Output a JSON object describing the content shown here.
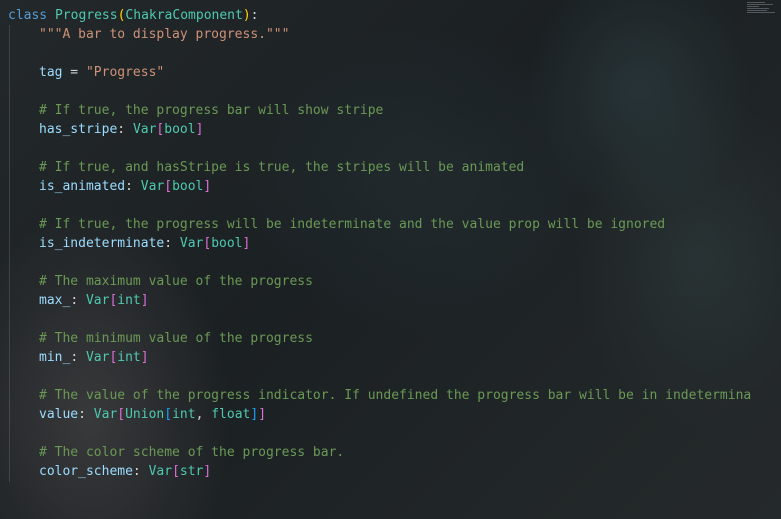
{
  "editor": {
    "lines": [
      {
        "tokens": [
          [
            "kw",
            "class"
          ],
          [
            "op",
            " "
          ],
          [
            "cls",
            "Progress"
          ],
          [
            "paren",
            "("
          ],
          [
            "cls",
            "ChakraComponent"
          ],
          [
            "paren",
            ")"
          ],
          [
            "op",
            ":"
          ]
        ],
        "indent": 0
      },
      {
        "tokens": [
          [
            "str",
            "\"\"\"A bar to display progress.\"\"\""
          ]
        ],
        "indent": 1
      },
      {
        "tokens": [],
        "indent": 0
      },
      {
        "tokens": [
          [
            "id",
            "tag"
          ],
          [
            "op",
            " = "
          ],
          [
            "str",
            "\"Progress\""
          ]
        ],
        "indent": 1
      },
      {
        "tokens": [],
        "indent": 0
      },
      {
        "tokens": [
          [
            "cmt",
            "# If true, the progress bar will show stripe"
          ]
        ],
        "indent": 1
      },
      {
        "tokens": [
          [
            "id",
            "has_stripe"
          ],
          [
            "op",
            ": "
          ],
          [
            "type",
            "Var"
          ],
          [
            "brk",
            "["
          ],
          [
            "type",
            "bool"
          ],
          [
            "brk",
            "]"
          ]
        ],
        "indent": 1
      },
      {
        "tokens": [],
        "indent": 0
      },
      {
        "tokens": [
          [
            "cmt",
            "# If true, and hasStripe is true, the stripes will be animated"
          ]
        ],
        "indent": 1
      },
      {
        "tokens": [
          [
            "id",
            "is_animated"
          ],
          [
            "op",
            ": "
          ],
          [
            "type",
            "Var"
          ],
          [
            "brk",
            "["
          ],
          [
            "type",
            "bool"
          ],
          [
            "brk",
            "]"
          ]
        ],
        "indent": 1
      },
      {
        "tokens": [],
        "indent": 0
      },
      {
        "tokens": [
          [
            "cmt",
            "# If true, the progress will be indeterminate and the value prop will be ignored"
          ]
        ],
        "indent": 1
      },
      {
        "tokens": [
          [
            "id",
            "is_indeterminate"
          ],
          [
            "op",
            ": "
          ],
          [
            "type",
            "Var"
          ],
          [
            "brk",
            "["
          ],
          [
            "type",
            "bool"
          ],
          [
            "brk",
            "]"
          ]
        ],
        "indent": 1
      },
      {
        "tokens": [],
        "indent": 0
      },
      {
        "tokens": [
          [
            "cmt",
            "# The maximum value of the progress"
          ]
        ],
        "indent": 1
      },
      {
        "tokens": [
          [
            "id",
            "max_"
          ],
          [
            "op",
            ": "
          ],
          [
            "type",
            "Var"
          ],
          [
            "brk",
            "["
          ],
          [
            "type",
            "int"
          ],
          [
            "brk",
            "]"
          ]
        ],
        "indent": 1
      },
      {
        "tokens": [],
        "indent": 0
      },
      {
        "tokens": [
          [
            "cmt",
            "# The minimum value of the progress"
          ]
        ],
        "indent": 1
      },
      {
        "tokens": [
          [
            "id",
            "min_"
          ],
          [
            "op",
            ": "
          ],
          [
            "type",
            "Var"
          ],
          [
            "brk",
            "["
          ],
          [
            "type",
            "int"
          ],
          [
            "brk",
            "]"
          ]
        ],
        "indent": 1
      },
      {
        "tokens": [],
        "indent": 0
      },
      {
        "tokens": [
          [
            "cmt",
            "# The value of the progress indicator. If undefined the progress bar will be in indetermina"
          ]
        ],
        "indent": 1
      },
      {
        "tokens": [
          [
            "id",
            "value"
          ],
          [
            "op",
            ": "
          ],
          [
            "type",
            "Var"
          ],
          [
            "brk",
            "["
          ],
          [
            "type",
            "Union"
          ],
          [
            "brk2",
            "["
          ],
          [
            "type",
            "int"
          ],
          [
            "op",
            ", "
          ],
          [
            "type",
            "float"
          ],
          [
            "brk2",
            "]"
          ],
          [
            "brk",
            "]"
          ]
        ],
        "indent": 1
      },
      {
        "tokens": [],
        "indent": 0
      },
      {
        "tokens": [
          [
            "cmt",
            "# The color scheme of the progress bar."
          ]
        ],
        "indent": 1
      },
      {
        "tokens": [
          [
            "id",
            "color_scheme"
          ],
          [
            "op",
            ": "
          ],
          [
            "type",
            "Var"
          ],
          [
            "brk",
            "["
          ],
          [
            "type",
            "str"
          ],
          [
            "brk",
            "]"
          ]
        ],
        "indent": 1
      }
    ]
  },
  "colors": {
    "keyword": "#569cd6",
    "class": "#4ec9b0",
    "string": "#ce9178",
    "comment": "#6a9955",
    "identifier": "#9cdcfe",
    "paren": "#ffd700",
    "bracket": "#da70d6",
    "bracket_nested": "#179fff"
  }
}
